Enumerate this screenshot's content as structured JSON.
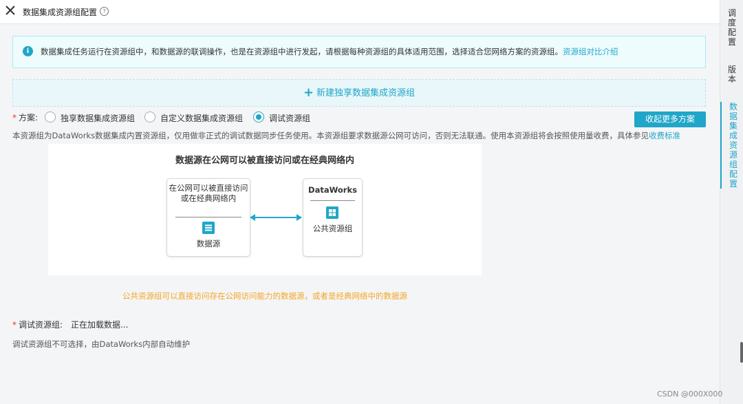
{
  "header": {
    "close_icon": "close-icon",
    "title": "数据集成资源组配置",
    "help_icon": "question-circle-icon"
  },
  "info": {
    "icon": "info-icon",
    "text": "数据集成任务运行在资源组中，和数据源的联调操作，也是在资源组中进行发起，请根据每种资源组的具体适用范围，选择适合您网络方案的资源组。",
    "link": "资源组对比介绍"
  },
  "new_group": {
    "plus": "+",
    "label": "新建独享数据集成资源组"
  },
  "plan": {
    "required": "*",
    "label": "方案:",
    "options": [
      {
        "label": "独享数据集成资源组",
        "selected": false
      },
      {
        "label": "自定义数据集成资源组",
        "selected": false
      },
      {
        "label": "调试资源组",
        "selected": true
      }
    ],
    "collapse_button": "收起更多方案"
  },
  "description": {
    "text": "本资源组为DataWorks数据集成内置资源组，仅用做非正式的调试数据同步任务使用。本资源组要求数据源公网可访问，否则无法联通。使用本资源组将会按照使用量收费，具体参见",
    "link": "收费标准"
  },
  "diagram": {
    "title": "数据源在公网可以被直接访问或在经典网络内",
    "left_card": {
      "text": "在公网可以被直接访问或在经典网络内",
      "label": "数据源",
      "icon": "database-icon"
    },
    "right_card": {
      "title": "DataWorks",
      "label": "公共资源组",
      "icon": "grid-icon"
    },
    "arrow_color": "#1fa6c8"
  },
  "note": "公共资源组可以直接访问存在公网访问能力的数据源，或者是经典网络中的数据源",
  "resource_group": {
    "required": "*",
    "label": "调试资源组:",
    "value": "正在加载数据...",
    "help": "调试资源组不可选择，由DataWorks内部自动维护"
  },
  "side_tabs": [
    {
      "label": "调度配置",
      "active": false
    },
    {
      "label": "版本",
      "active": false
    },
    {
      "label": "数据集成资源组配置",
      "active": true
    }
  ],
  "watermark": "CSDN @000X000",
  "colors": {
    "accent": "#1fa6c8",
    "warning": "#f5a623",
    "required": "#e33333"
  }
}
